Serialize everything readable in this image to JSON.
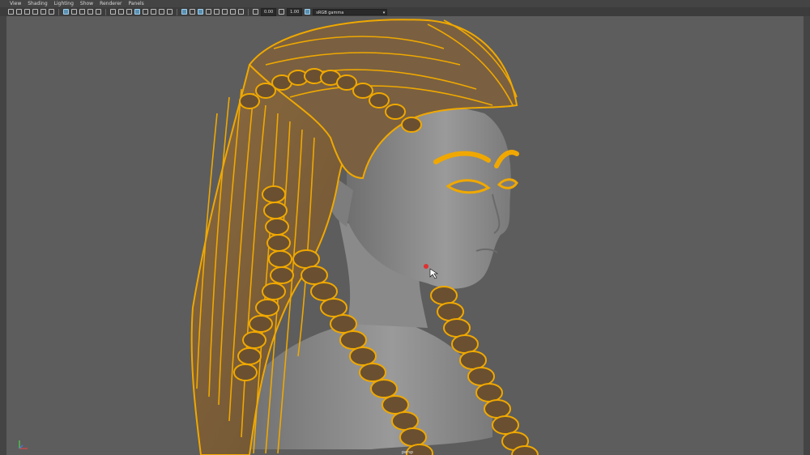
{
  "menu": [
    "View",
    "Shading",
    "Lighting",
    "Show",
    "Renderer",
    "Panels"
  ],
  "toolbar": {
    "exposure": "0.00",
    "gamma": "1.00",
    "color_space": "sRGB gamma"
  },
  "viewport": {
    "camera": "persp"
  },
  "colors": {
    "hair_wire": "#f0a800",
    "skin": "#8a8a8a",
    "background": "#5d5d5d"
  },
  "icons": [
    "camera-icon",
    "grid-icon",
    "wireframe-icon",
    "smooth-shade-icon",
    "lighting-icon",
    "xray-icon",
    "color-management-icon"
  ]
}
